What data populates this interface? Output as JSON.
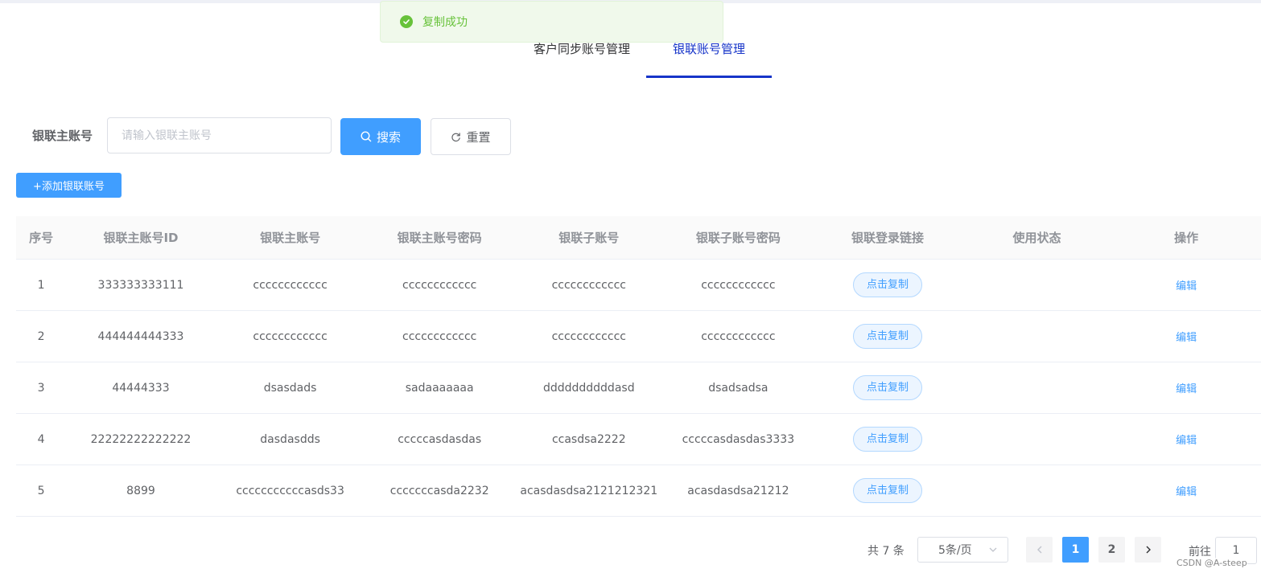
{
  "toast": {
    "message": "复制成功",
    "color": "#67c23a"
  },
  "tabs": [
    {
      "label": "客户同步账号管理",
      "active": false
    },
    {
      "label": "银联账号管理",
      "active": true
    }
  ],
  "search": {
    "label": "银联主账号",
    "placeholder": "请输入银联主账号",
    "value": "",
    "search_label": "搜索",
    "reset_label": "重置"
  },
  "add_button_label": "+添加银联账号",
  "table": {
    "headers": [
      "序号",
      "银联主账号ID",
      "银联主账号",
      "银联主账号密码",
      "银联子账号",
      "银联子账号密码",
      "银联登录链接",
      "使用状态",
      "操作"
    ],
    "rows": [
      {
        "index": "1",
        "main_id": "333333333111",
        "main_account": "cccccccccccc",
        "main_password": "cccccccccccc",
        "sub_account": "cccccccccccc",
        "sub_password": "cccccccccccc",
        "link_label": "点击复制",
        "status": "",
        "action": "编辑"
      },
      {
        "index": "2",
        "main_id": "444444444333",
        "main_account": "cccccccccccc",
        "main_password": "cccccccccccc",
        "sub_account": "cccccccccccc",
        "sub_password": "cccccccccccc",
        "link_label": "点击复制",
        "status": "",
        "action": "编辑"
      },
      {
        "index": "3",
        "main_id": "44444333",
        "main_account": "dsasdads",
        "main_password": "sadaaaaaaa",
        "sub_account": "ddddddddddasd",
        "sub_password": "dsadsadsa",
        "link_label": "点击复制",
        "status": "",
        "action": "编辑"
      },
      {
        "index": "4",
        "main_id": "22222222222222",
        "main_account": "dasdasdds",
        "main_password": "cccccasdasdas",
        "sub_account": "ccasdsa2222",
        "sub_password": "cccccasdasdas3333",
        "link_label": "点击复制",
        "status": "",
        "action": "编辑"
      },
      {
        "index": "5",
        "main_id": "8899",
        "main_account": "cccccccccccasds33",
        "main_password": "cccccccasda2232",
        "sub_account": "acasdasdsa2121212321",
        "sub_password": "acasdasdsa21212",
        "link_label": "点击复制",
        "status": "",
        "action": "编辑"
      }
    ]
  },
  "pagination": {
    "total_text": "共 7 条",
    "page_size": "5条/页",
    "pages": [
      "1",
      "2"
    ],
    "current_page": "1",
    "goto_label": "前往",
    "goto_value": "1"
  },
  "watermark": "CSDN @A-steep",
  "colors": {
    "primary": "#409eff",
    "tab_active": "#1634c9",
    "success": "#67c23a"
  }
}
